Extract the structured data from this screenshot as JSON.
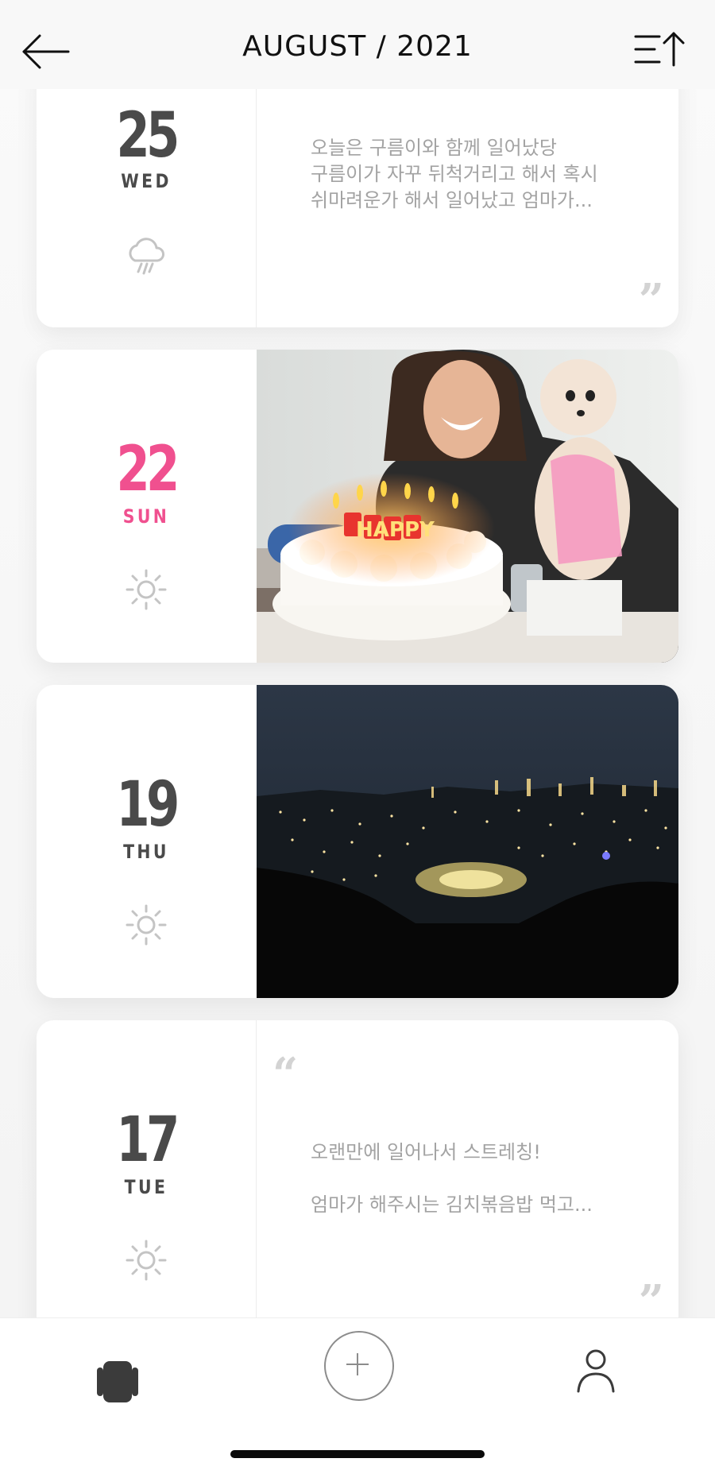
{
  "header": {
    "title": "AUGUST / 2021",
    "back_icon": "arrow-left-icon",
    "sort_icon": "sort-ascending-icon"
  },
  "entries": [
    {
      "day": "25",
      "weekday": "WED",
      "weather": "rain-cloud-icon",
      "type": "text",
      "text_lines": [
        "오늘은 구름이와 함께 일어났당",
        "구름이가 자꾸 뒤척거리고 해서 혹시",
        "쉬마려운가 해서 일어났고 엄마가..."
      ]
    },
    {
      "day": "22",
      "weekday": "SUN",
      "weather": "sun-icon",
      "type": "photo",
      "photo": "birthday-cake-with-puppy-photo",
      "cake_text": "HAPPY",
      "day_color": "#f0508f"
    },
    {
      "day": "19",
      "weekday": "THU",
      "weather": "sun-icon",
      "type": "photo",
      "photo": "night-city-view-photo"
    },
    {
      "day": "17",
      "weekday": "TUE",
      "weather": "sun-icon",
      "type": "text",
      "text_lines": [
        "오랜만에 일어나서 스트레칭!",
        "엄마가 해주시는 김치볶음밥 먹고..."
      ]
    }
  ],
  "quotes": {
    "open": "“",
    "close": "”"
  },
  "bottom_nav": {
    "feed_icon": "cards-icon",
    "add_icon": "plus-icon",
    "profile_icon": "user-icon"
  },
  "colors": {
    "accent_pink": "#f0508f",
    "day_gray": "#4a4a4a",
    "text_gray": "#a3a3a3"
  }
}
